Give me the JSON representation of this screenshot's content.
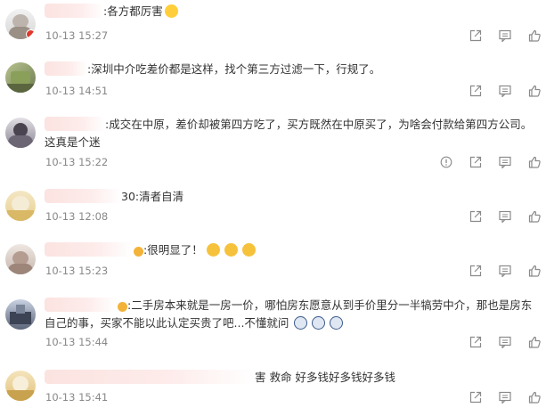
{
  "comments": [
    {
      "text": ":各方都厉害",
      "time": "10-13 15:27"
    },
    {
      "text": ":深圳中介吃差价都是这样，找个第三方过滤一下，行规了。",
      "time": "10-13 14:51"
    },
    {
      "text": ":成交在中原，差价却被第四方吃了，买方既然在中原买了，为啥会付款给第四方公司。这真是个迷",
      "time": "10-13 15:22"
    },
    {
      "text": "30:清者自清",
      "time": "10-13 12:08"
    },
    {
      "text": ":很明显了！",
      "time": "10-13 15:23"
    },
    {
      "text": ":二手房本来就是一房一价，哪怕房东愿意从到手价里分一半犒劳中介，那也是房东自己的事，买家不能以此认定买贵了吧...不懂就问",
      "time": "10-13 15:44"
    },
    {
      "text": "害 救命 好多钱好多钱好多钱",
      "time": "10-13 15:41"
    }
  ],
  "icons": {
    "report": "report-icon",
    "share": "share-icon",
    "comment": "comment-icon",
    "like": "like-icon"
  },
  "colors": {
    "text": "#333333",
    "time": "#888888",
    "icon": "#8a8a8a"
  }
}
